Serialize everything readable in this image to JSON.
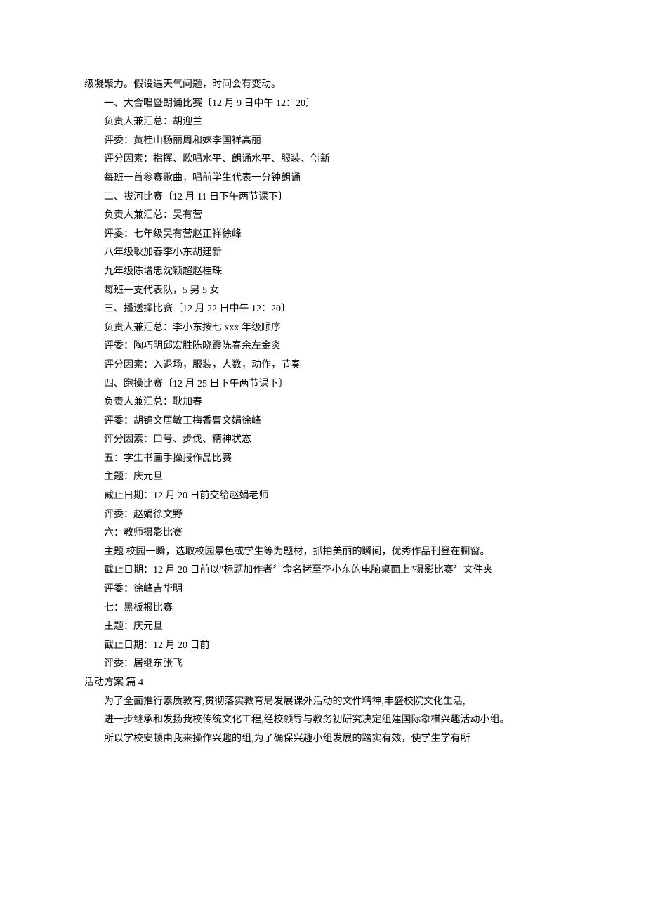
{
  "lines": [
    {
      "text": "级凝聚力。假设遇天气问题，时间会有变动。",
      "indent": false
    },
    {
      "text": "一、大合唱暨朗诵比赛〔12 月 9 日中午 12：20〕",
      "indent": true
    },
    {
      "text": "负责人兼汇总：胡迎兰",
      "indent": true
    },
    {
      "text": "评委：黄桂山杨丽周和妹李国祥高丽",
      "indent": true
    },
    {
      "text": "评分因素：指挥、歌唱水平、朗诵水平、服装、创新",
      "indent": true
    },
    {
      "text": "每班一首参赛歌曲，唱前学生代表一分钟朗诵",
      "indent": true
    },
    {
      "text": "二、拔河比赛〔12 月 11 日下午两节课下〕",
      "indent": true
    },
    {
      "text": "负责人兼汇总：吴有营",
      "indent": true
    },
    {
      "text": "评委：七年级吴有营赵正祥徐峰",
      "indent": true
    },
    {
      "text": "八年级耿加春李小东胡建新",
      "indent": true
    },
    {
      "text": "九年级陈增忠沈颖超赵桂珠",
      "indent": true
    },
    {
      "text": "每班一支代表队，5 男 5 女",
      "indent": true
    },
    {
      "text": "三、播送操比赛〔12 月 22 日中午 12：20〕",
      "indent": true
    },
    {
      "text": "负责人兼汇总：李小东按七 xxx 年级顺序",
      "indent": true
    },
    {
      "text": "评委：陶巧明邱宏胜陈晓霞陈春余左金炎",
      "indent": true
    },
    {
      "text": "评分因素：入退场，服装，人数，动作，节奏",
      "indent": true
    },
    {
      "text": "四、跑操比赛〔12 月 25 日下午两节课下〕",
      "indent": true
    },
    {
      "text": "负责人兼汇总：耿加春",
      "indent": true
    },
    {
      "text": "评委：胡锦文居敏王梅香曹文娟徐峰",
      "indent": true
    },
    {
      "text": "评分因素：口号、步伐、精神状态",
      "indent": true
    },
    {
      "text": "五：学生书画手操报作品比赛",
      "indent": true
    },
    {
      "text": "主题：庆元旦",
      "indent": true
    },
    {
      "text": "截止日期：12 月 20 日前交给赵娟老师",
      "indent": true
    },
    {
      "text": "评委：赵娟徐文野",
      "indent": true
    },
    {
      "text": "六：教师摄影比赛",
      "indent": true
    },
    {
      "text": "主题 校园一瞬，选取校园景色或学生等为题材，抓拍美丽的瞬间，优秀作品刊登在橱窗。",
      "indent": true
    },
    {
      "text": "截止日期：12 月 20 日前以\"标题加作者〞命名拷至李小东的电脑桌面上\"摄影比赛〞文件夹",
      "indent": true
    },
    {
      "text": "评委：徐峰吉华明",
      "indent": true
    },
    {
      "text": "七：黑板报比赛",
      "indent": true
    },
    {
      "text": "主题：庆元旦",
      "indent": true
    },
    {
      "text": "截止日期：12 月 20 日前",
      "indent": true
    },
    {
      "text": "评委：居继东张飞",
      "indent": true
    },
    {
      "text": "活动方案  篇 4",
      "indent": false
    },
    {
      "text": "为了全面推行素质教育,贯彻落实教育局发展课外活动的文件精神,丰盛校院文化生活,",
      "indent": true
    },
    {
      "text": "进一步继承和发扬我校传统文化工程,经校领导与教务初研究决定组建国际象棋兴趣活动小组。",
      "indent": true
    },
    {
      "text": "所以学校安顿由我来操作兴趣的组,为了确保兴趣小组发展的踏实有效，使学生学有所",
      "indent": true
    }
  ]
}
